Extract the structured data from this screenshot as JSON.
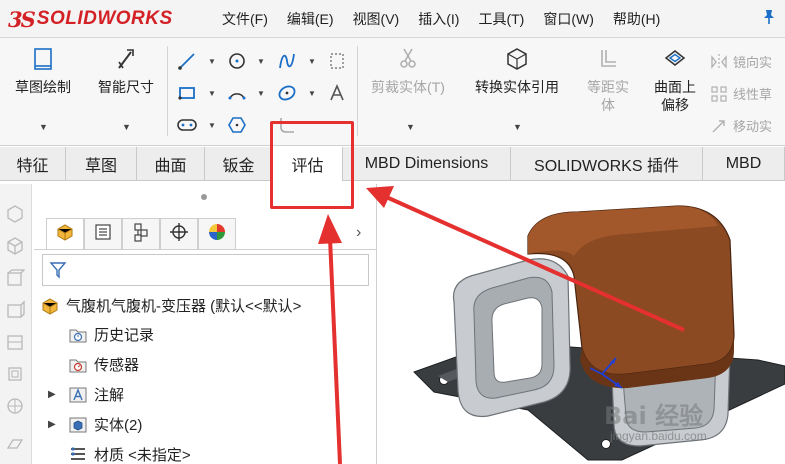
{
  "titlebar": {
    "logo_ds": "3S",
    "logo_text": "SOLIDWORKS",
    "menu": [
      "文件(F)",
      "编辑(E)",
      "视图(V)",
      "插入(I)",
      "工具(T)",
      "窗口(W)",
      "帮助(H)"
    ],
    "pin_icon": "pin-icon"
  },
  "ribbon": {
    "sketch_label": "草图绘制",
    "smart_dim_label": "智能尺寸",
    "trim_label": "剪裁实体(T)",
    "convert_label": "转换实体引用",
    "offset_dist_label_1": "等距实",
    "offset_dist_label_2": "体",
    "offset_surface_label_1": "曲面上",
    "offset_surface_label_2": "偏移",
    "mirror_label": "镜向实",
    "linear_label": "线性草",
    "move_label": "移动实"
  },
  "tabs": [
    "特征",
    "草图",
    "曲面",
    "钣金",
    "评估",
    "MBD Dimensions",
    "SOLIDWORKS 插件",
    "MBD"
  ],
  "active_tab": "评估",
  "tree": {
    "root": "气腹机气腹机-变压器 (默认<<默认>",
    "items": [
      {
        "label": "历史记录",
        "icon": "history-icon",
        "expandable": false
      },
      {
        "label": "传感器",
        "icon": "sensor-icon",
        "expandable": false
      },
      {
        "label": "注解",
        "icon": "annotation-icon",
        "expandable": true
      },
      {
        "label": "实体(2)",
        "icon": "solid-bodies-icon",
        "expandable": true
      },
      {
        "label": "材质 <未指定>",
        "icon": "material-icon",
        "expandable": false
      }
    ]
  },
  "watermark": {
    "logo": "Bai 经验",
    "url": "jingyan.baidu.com"
  },
  "colors": {
    "accent_red": "#e53030",
    "logo_red": "#d32126",
    "coil_brown": "#8b4a22",
    "metal_gray": "#bfc3c6"
  }
}
